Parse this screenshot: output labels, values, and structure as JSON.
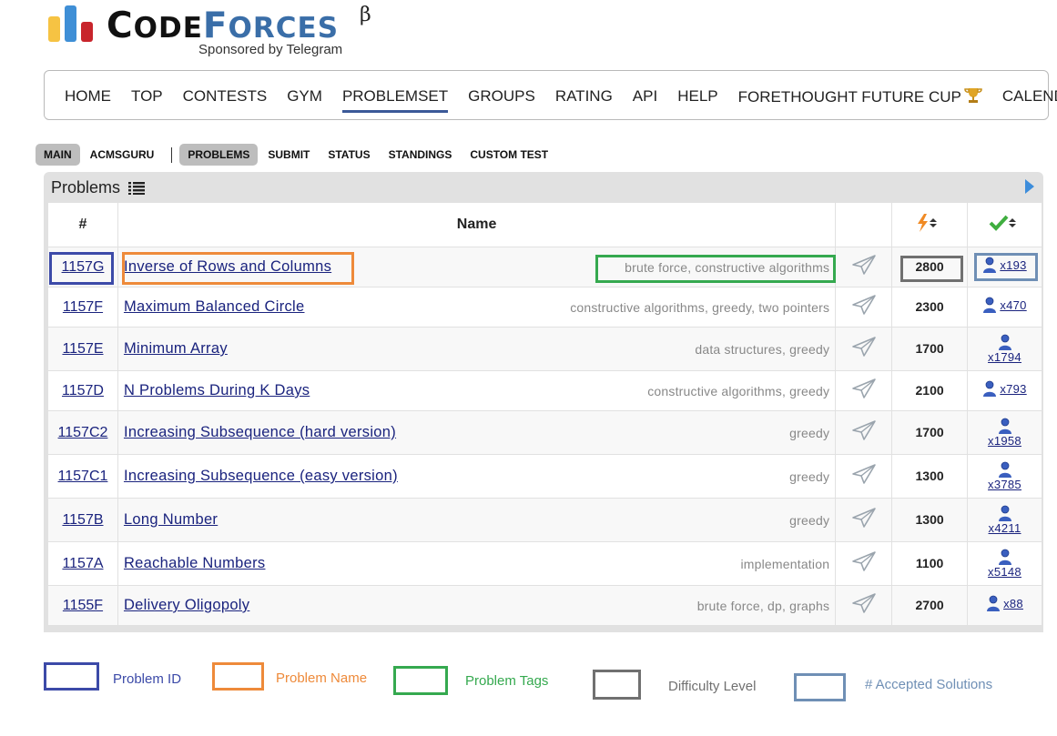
{
  "brand": {
    "logo_text": "CODEFORCES",
    "beta": "β",
    "sponsor": "Sponsored by Telegram",
    "colors": {
      "bar1": "#f6c343",
      "bar2": "#3f8fd6",
      "bar3": "#c8252c"
    }
  },
  "main_menu": {
    "items": [
      "HOME",
      "TOP",
      "CONTESTS",
      "GYM",
      "PROBLEMSET",
      "GROUPS",
      "RATING",
      "API",
      "HELP",
      "FORETHOUGHT FUTURE CUP",
      "CALENDAR"
    ],
    "active": "PROBLEMSET",
    "icons": {
      "FORETHOUGHT FUTURE CUP": "trophy-icon"
    }
  },
  "sub_menu": {
    "left": [
      "MAIN",
      "ACMSGURU"
    ],
    "right": [
      "PROBLEMS",
      "SUBMIT",
      "STATUS",
      "STANDINGS",
      "CUSTOM TEST"
    ],
    "selected": [
      "MAIN",
      "PROBLEMS"
    ]
  },
  "panel": {
    "title": "Problems",
    "title_icon": "list-icon",
    "corner_icon": "right-arrow-icon"
  },
  "table": {
    "headers": {
      "id": "#",
      "name": "Name",
      "send": "",
      "difficulty_icon": "lightning-sort-icon",
      "solved_icon": "checkmark-sort-icon"
    },
    "rows": [
      {
        "id": "1157G",
        "name": "Inverse of Rows and Columns",
        "tags": [
          "brute force",
          "constructive algorithms"
        ],
        "difficulty": "2800",
        "solved": "x193",
        "solved_layout": "inline"
      },
      {
        "id": "1157F",
        "name": "Maximum Balanced Circle",
        "tags": [
          "constructive algorithms",
          "greedy",
          "two pointers"
        ],
        "difficulty": "2300",
        "solved": "x470",
        "solved_layout": "inline"
      },
      {
        "id": "1157E",
        "name": "Minimum Array",
        "tags": [
          "data structures",
          "greedy"
        ],
        "difficulty": "1700",
        "solved": "x1794",
        "solved_layout": "stack"
      },
      {
        "id": "1157D",
        "name": "N Problems During K Days",
        "tags": [
          "constructive algorithms",
          "greedy"
        ],
        "difficulty": "2100",
        "solved": "x793",
        "solved_layout": "inline"
      },
      {
        "id": "1157C2",
        "name": "Increasing Subsequence (hard version)",
        "tags": [
          "greedy"
        ],
        "difficulty": "1700",
        "solved": "x1958",
        "solved_layout": "stack"
      },
      {
        "id": "1157C1",
        "name": "Increasing Subsequence (easy version)",
        "tags": [
          "greedy"
        ],
        "difficulty": "1300",
        "solved": "x3785",
        "solved_layout": "stack"
      },
      {
        "id": "1157B",
        "name": "Long Number",
        "tags": [
          "greedy"
        ],
        "difficulty": "1300",
        "solved": "x4211",
        "solved_layout": "stack"
      },
      {
        "id": "1157A",
        "name": "Reachable Numbers",
        "tags": [
          "implementation"
        ],
        "difficulty": "1100",
        "solved": "x5148",
        "solved_layout": "stack"
      },
      {
        "id": "1155F",
        "name": "Delivery Oligopoly",
        "tags": [
          "brute force",
          "dp",
          "graphs"
        ],
        "difficulty": "2700",
        "solved": "x88",
        "solved_layout": "inline"
      }
    ]
  },
  "legend": [
    {
      "label": "Problem ID",
      "color": "#3c4aa8",
      "text_color": "#3c4aa8"
    },
    {
      "label": "Problem Name",
      "color": "#ee8a3a",
      "text_color": "#ee8a3a"
    },
    {
      "label": "Problem Tags",
      "color": "#35a94f",
      "text_color": "#35a94f"
    },
    {
      "label": "Difficulty Level",
      "color": "#707070",
      "text_color": "#707070"
    },
    {
      "label": "# Accepted Solutions",
      "color": "#6f8fb5",
      "text_color": "#6f8fb5"
    }
  ]
}
